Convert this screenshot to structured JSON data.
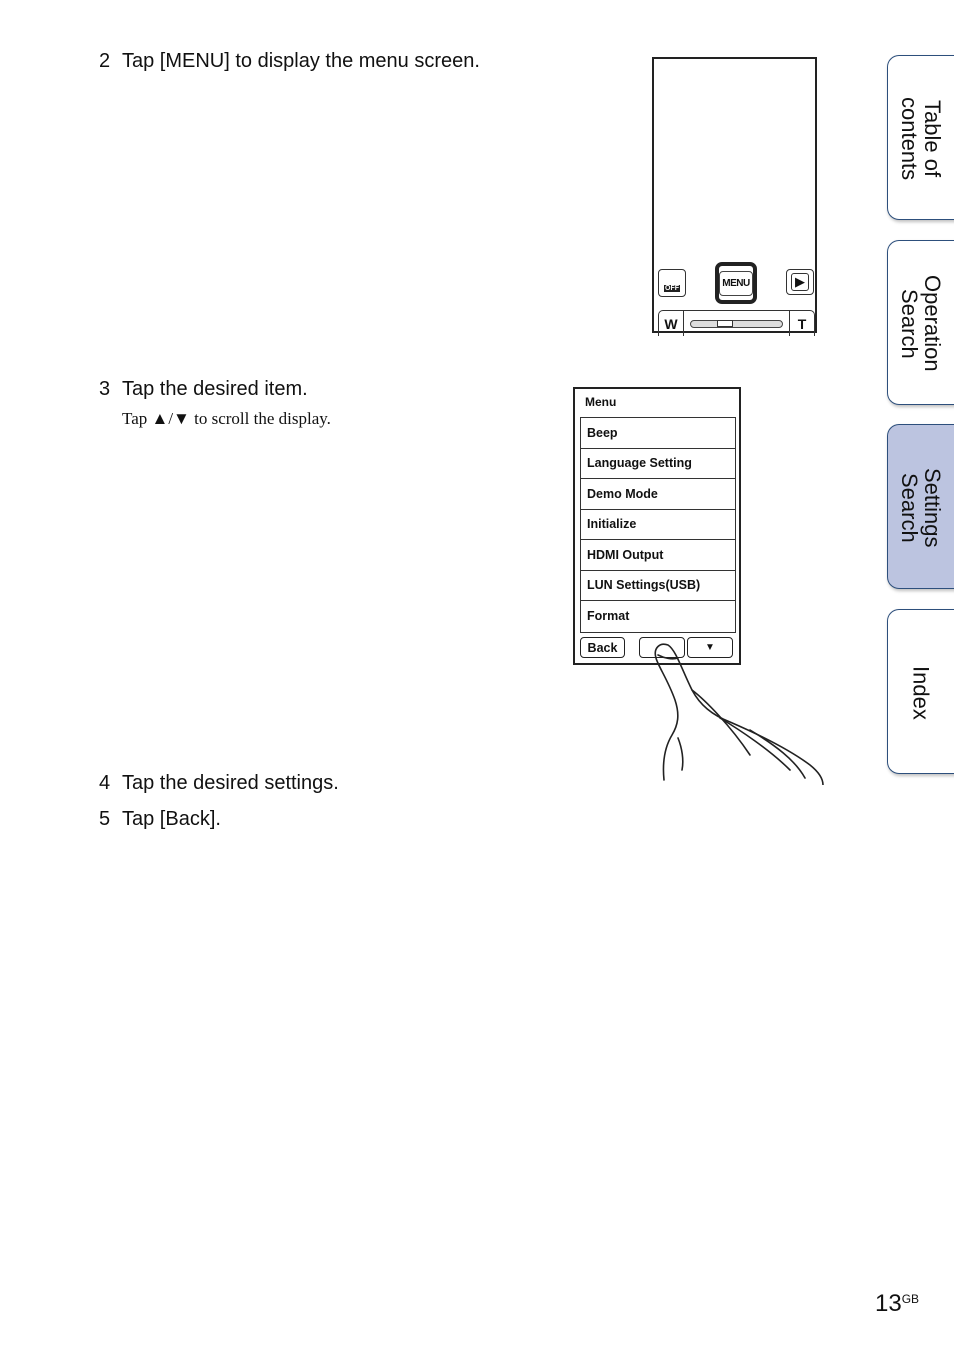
{
  "steps": [
    {
      "num": "2",
      "text": "Tap [MENU] to display the menu screen."
    },
    {
      "num": "3",
      "text": "Tap the desired item.",
      "note": "Tap ▲/▼ to scroll the display."
    },
    {
      "num": "4",
      "text": "Tap the desired settings."
    },
    {
      "num": "5",
      "text": "Tap [Back]."
    }
  ],
  "camera_screen": {
    "left_icon_badge": "OFF",
    "menu_button": "MENU",
    "play_icon": "▶",
    "zoom_wide": "W",
    "zoom_tele": "T"
  },
  "menu_screen": {
    "title": "Menu",
    "items": [
      "Beep",
      "Language Setting",
      "Demo Mode",
      "Initialize",
      "HDMI Output",
      "LUN Settings(USB)",
      "Format"
    ],
    "back_label": "Back",
    "down_label": "▼"
  },
  "side_tabs": [
    {
      "label": "Table of\ncontents",
      "active": false
    },
    {
      "label": "Operation\nSearch",
      "active": false
    },
    {
      "label": "Settings\nSearch",
      "active": true
    },
    {
      "label": "Index",
      "active": false
    }
  ],
  "page": {
    "number": "13",
    "suffix": "GB"
  }
}
